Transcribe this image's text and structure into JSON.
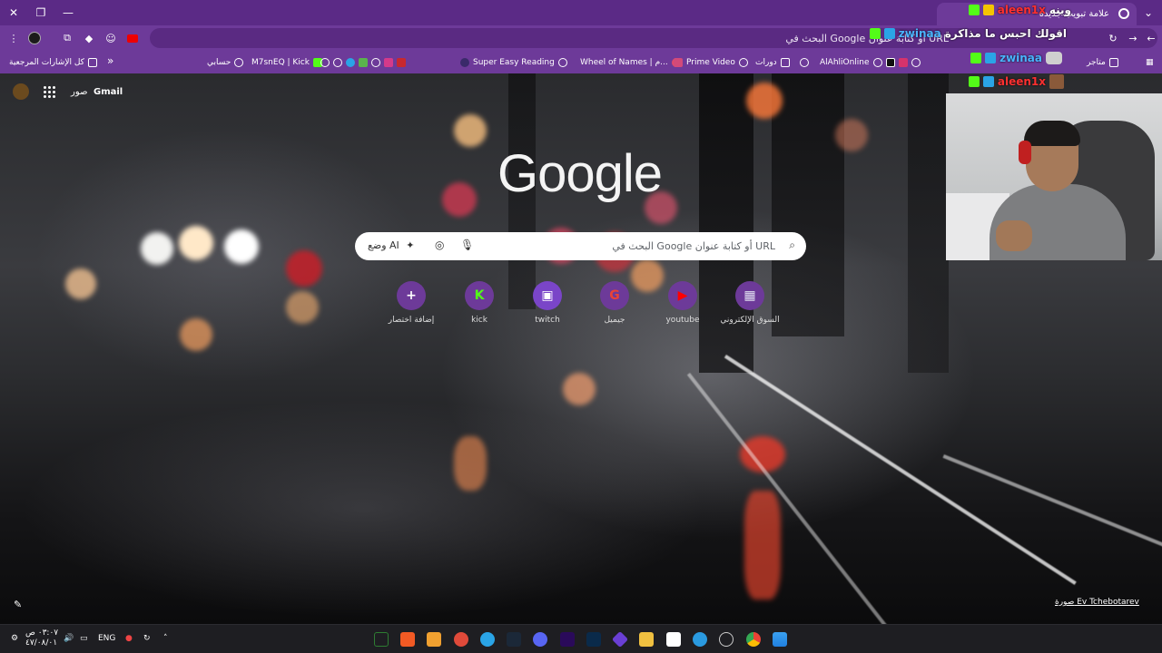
{
  "window": {
    "tab_title": "علامة تبويب جديدة",
    "close": "✕",
    "restore": "❐",
    "minimize": "—"
  },
  "toolbar": {
    "omnibox_placeholder": "البحث في Google أو كتابة عنوان URL"
  },
  "bookmarks": {
    "all_bookmarks": "كل الإشارات المرجعية",
    "chevron": "»",
    "items": [
      {
        "label": "حسابي",
        "icon": "globe-icon"
      },
      {
        "label": "M7snEQ | Kick",
        "icon": "kick-icon"
      },
      {
        "label": "Super Easy Reading",
        "icon": "globe-icon"
      },
      {
        "label": "Wheel of Names | م...",
        "icon": "globe-icon"
      },
      {
        "label": "Prime Video",
        "icon": "globe-icon"
      },
      {
        "label": "دورات",
        "icon": "folder-icon"
      },
      {
        "label": "AlAhliOnline",
        "icon": "globe-icon"
      },
      {
        "label": "متاجر",
        "icon": "folder-icon"
      }
    ]
  },
  "chat": [
    {
      "user": "aleen1x",
      "message": "وينه"
    },
    {
      "user": "zwinaa",
      "message": "اقولك احبس ما مذاكرة"
    },
    {
      "user": "zwinaa",
      "message": ""
    },
    {
      "user": "aleen1x",
      "message": ""
    }
  ],
  "ntp": {
    "gmail": "Gmail",
    "images": "صور",
    "logo": "Google",
    "search_placeholder": "البحث في Google أو كتابة عنوان URL",
    "ai_mode": "وضع AI",
    "shortcuts": [
      {
        "label": "إضافة اختصار",
        "glyph": "+",
        "color": "#6d3a99"
      },
      {
        "label": "kick",
        "glyph": "K",
        "color": "#53fc18"
      },
      {
        "label": "twitch",
        "glyph": "▣",
        "color": "#9146ff"
      },
      {
        "label": "جيميل",
        "glyph": "G",
        "color": "#ffffff"
      },
      {
        "label": "youtube",
        "glyph": "▶",
        "color": "#ff0000"
      },
      {
        "label": "السوق الإلكتروني",
        "glyph": "▦",
        "color": "#e0e0f0"
      }
    ],
    "photo_credit": "صورة Ev Tchebotarev",
    "edit_icon": "✎"
  },
  "taskbar": {
    "time": "٠٣:٠٧ ص",
    "date": "٤٧/٠٨/٠١",
    "lang": "ENG"
  },
  "colors": {
    "chrome_purple": "#6d3a99",
    "title_purple": "#5b2a86",
    "kick_green": "#53fc18",
    "twitch_purple": "#9146ff"
  }
}
